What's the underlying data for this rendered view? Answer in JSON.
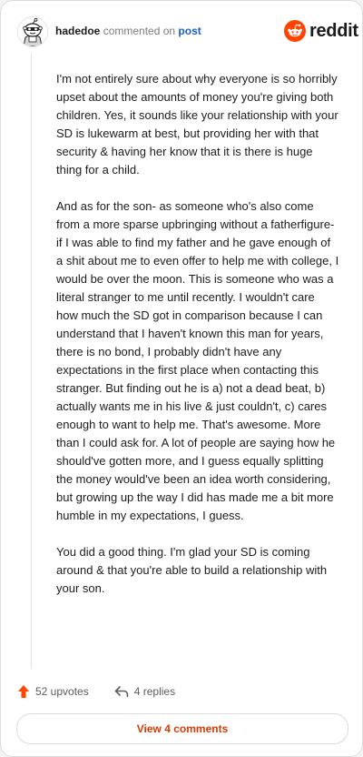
{
  "comment": {
    "username": "hadedoe",
    "action_text": "commented on",
    "post_link_text": "post"
  },
  "brand": {
    "wordmark": "reddit",
    "accent_color": "#ff4500"
  },
  "body": {
    "paragraphs": [
      "I'm not entirely sure about why everyone is so horribly upset about the amounts of money you're giving both children. Yes, it sounds like your relationship with your SD is lukewarm at best, but providing her with that security & having her know that it is there is huge thing for a child.",
      "And as for the son- as someone who's also come from a more sparse upbringing without a fatherfigure- if I was able to find my father and he gave enough of a shit about me to even offer to help me with college, I would be over the moon. This is someone who was a literal stranger to me until recently. I wouldn't care how much the SD got in comparison because I can understand that I haven't known this man for years, there is no bond, I probably didn't have any expectations in the first place when contacting this stranger. But finding out he is a) not a dead beat, b) actually wants me in his live & just couldn't, c) cares enough to want to help me. That's awesome. More than I could ask for. A lot of people are saying how he should've gotten more, and I guess equally splitting the money would've been an idea worth considering, but growing up the way I did has made me a bit more humble in my expectations, I guess.",
      "You did a good thing. I'm glad your SD is coming around & that you're able to build a relationship with your son."
    ]
  },
  "footer": {
    "upvotes_text": "52 upvotes",
    "replies_text": "4 replies",
    "upvote_icon": "upvote-arrow-icon",
    "reply_icon": "reply-arrow-icon",
    "upvote_color": "#ff4500"
  },
  "view_button": {
    "label": "View 4 comments",
    "color": "#d93a00"
  }
}
